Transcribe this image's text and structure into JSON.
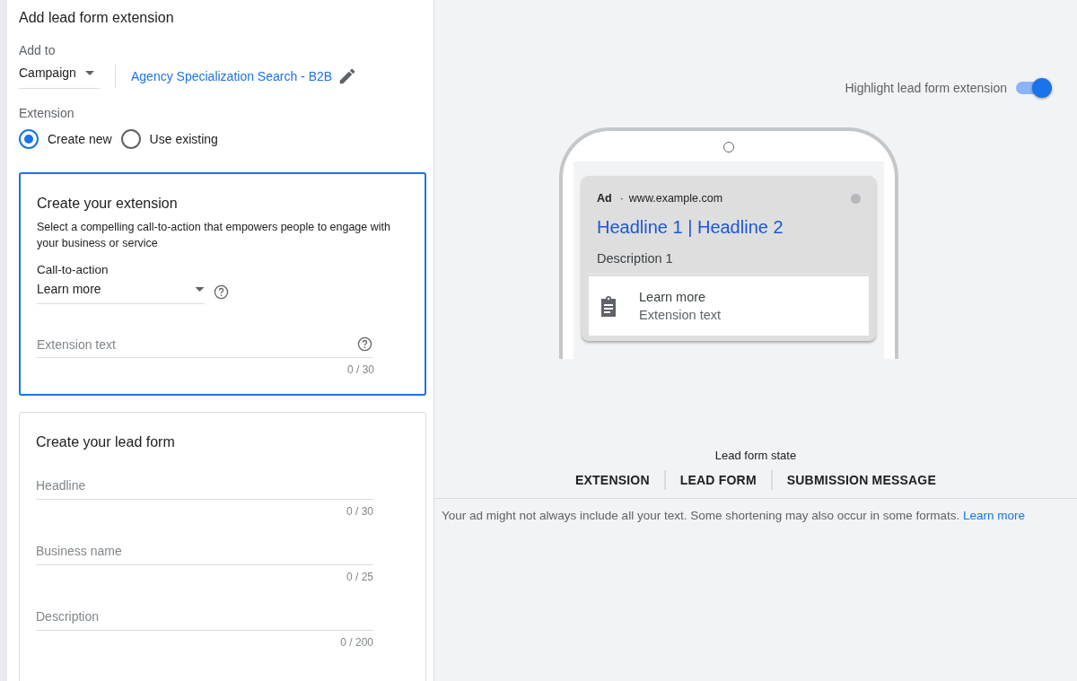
{
  "title": "Add lead form extension",
  "add_to": {
    "label": "Add to",
    "dropdown": "Campaign",
    "campaign_link": "Agency Specialization Search - B2B"
  },
  "extension": {
    "label": "Extension",
    "options": [
      {
        "label": "Create new",
        "selected": true
      },
      {
        "label": "Use existing",
        "selected": false
      }
    ]
  },
  "create_extension": {
    "title": "Create your extension",
    "description": "Select a compelling call-to-action that empowers people to engage with your business or service",
    "cta_label": "Call-to-action",
    "cta_value": "Learn more",
    "extension_text": {
      "placeholder": "Extension text",
      "counter": "0 / 30"
    }
  },
  "lead_form": {
    "title": "Create your lead form",
    "fields": [
      {
        "placeholder": "Headline",
        "counter": "0 / 30"
      },
      {
        "placeholder": "Business name",
        "counter": "0 / 25"
      },
      {
        "placeholder": "Description",
        "counter": "0 / 200"
      }
    ]
  },
  "preview": {
    "highlight_label": "Highlight lead form extension",
    "highlight_on": true,
    "ad": {
      "badge": "Ad",
      "separator": "·",
      "url": "www.example.com",
      "headline": "Headline 1 | Headline 2",
      "description": "Description 1",
      "extension_title": "Learn more",
      "extension_text": "Extension text"
    },
    "state_label": "Lead form state",
    "states": [
      "EXTENSION",
      "LEAD FORM",
      "SUBMISSION MESSAGE"
    ],
    "note": "Your ad might not always include all your text. Some shortening may also occur in some formats.",
    "note_link": "Learn more"
  }
}
